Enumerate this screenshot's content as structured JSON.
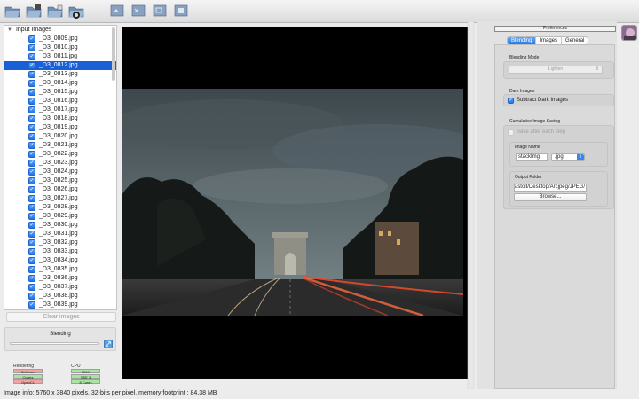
{
  "toolbar": {
    "buttons": [
      {
        "name": "open-folder-icon"
      },
      {
        "name": "add-folder-icon"
      },
      {
        "name": "save-folder-icon"
      },
      {
        "name": "process-folder-icon"
      },
      {
        "name": "rotate-left-icon"
      },
      {
        "name": "zoom-in-icon"
      },
      {
        "name": "zoom-out-icon"
      },
      {
        "name": "fit-view-icon"
      }
    ]
  },
  "input_images": {
    "title": "Input Images",
    "selected_index": 3,
    "items": [
      "_D3_0809.jpg",
      "_D3_0810.jpg",
      "_D3_0811.jpg",
      "_D3_0812.jpg",
      "_D3_0813.jpg",
      "_D3_0814.jpg",
      "_D3_0815.jpg",
      "_D3_0816.jpg",
      "_D3_0817.jpg",
      "_D3_0818.jpg",
      "_D3_0819.jpg",
      "_D3_0820.jpg",
      "_D3_0821.jpg",
      "_D3_0822.jpg",
      "_D3_0823.jpg",
      "_D3_0824.jpg",
      "_D3_0825.jpg",
      "_D3_0826.jpg",
      "_D3_0827.jpg",
      "_D3_0828.jpg",
      "_D3_0829.jpg",
      "_D3_0830.jpg",
      "_D3_0831.jpg",
      "_D3_0832.jpg",
      "_D3_0833.jpg",
      "_D3_0834.jpg",
      "_D3_0835.jpg",
      "_D3_0836.jpg",
      "_D3_0837.jpg",
      "_D3_0838.jpg",
      "_D3_0839.jpg"
    ]
  },
  "left_bottom": {
    "clear_label": "Clear images",
    "blending_label": "Blending",
    "progress": 0.0
  },
  "rendering": {
    "title": "Rendering",
    "badges": [
      {
        "label": "Software",
        "color": "#f2a3a3"
      },
      {
        "label": "Quartz",
        "color": "#a8e6a0"
      },
      {
        "label": "OpenCL",
        "color": "#f2a3a3"
      }
    ]
  },
  "cpu": {
    "title": "CPU",
    "badges": [
      {
        "label": "MMX",
        "color": "#a8e6a0"
      },
      {
        "label": "SSE 3",
        "color": "#a8e6a0"
      },
      {
        "label": "8 Cores",
        "color": "#a8e6a0"
      }
    ]
  },
  "status_bar": {
    "text": "Image info: 5760 x 3840 pixels, 32-bits per pixel, memory footprint : 84.38 MB"
  },
  "preferences": {
    "title": "Preferences",
    "tabs": [
      "Blending",
      "Images",
      "General"
    ],
    "active_tab": 0,
    "blending_mode": {
      "label": "Blending Mode",
      "value": "Lighten"
    },
    "dark_images": {
      "label": "Dark Images",
      "checkbox_label": "Subtract Dark Images",
      "checked": true
    },
    "cumulative": {
      "label": "Cumulative Image Saving",
      "checkbox_label": "Save after each step",
      "checked": false
    },
    "image_name": {
      "label": "Image Name",
      "value": "stackImg",
      "extension": ".jpg"
    },
    "output_folder": {
      "label": "Output Folder",
      "value": "/Users/stoit/Desktop/Arcjpeg/JPEG",
      "browse_label": "Browse..."
    }
  }
}
